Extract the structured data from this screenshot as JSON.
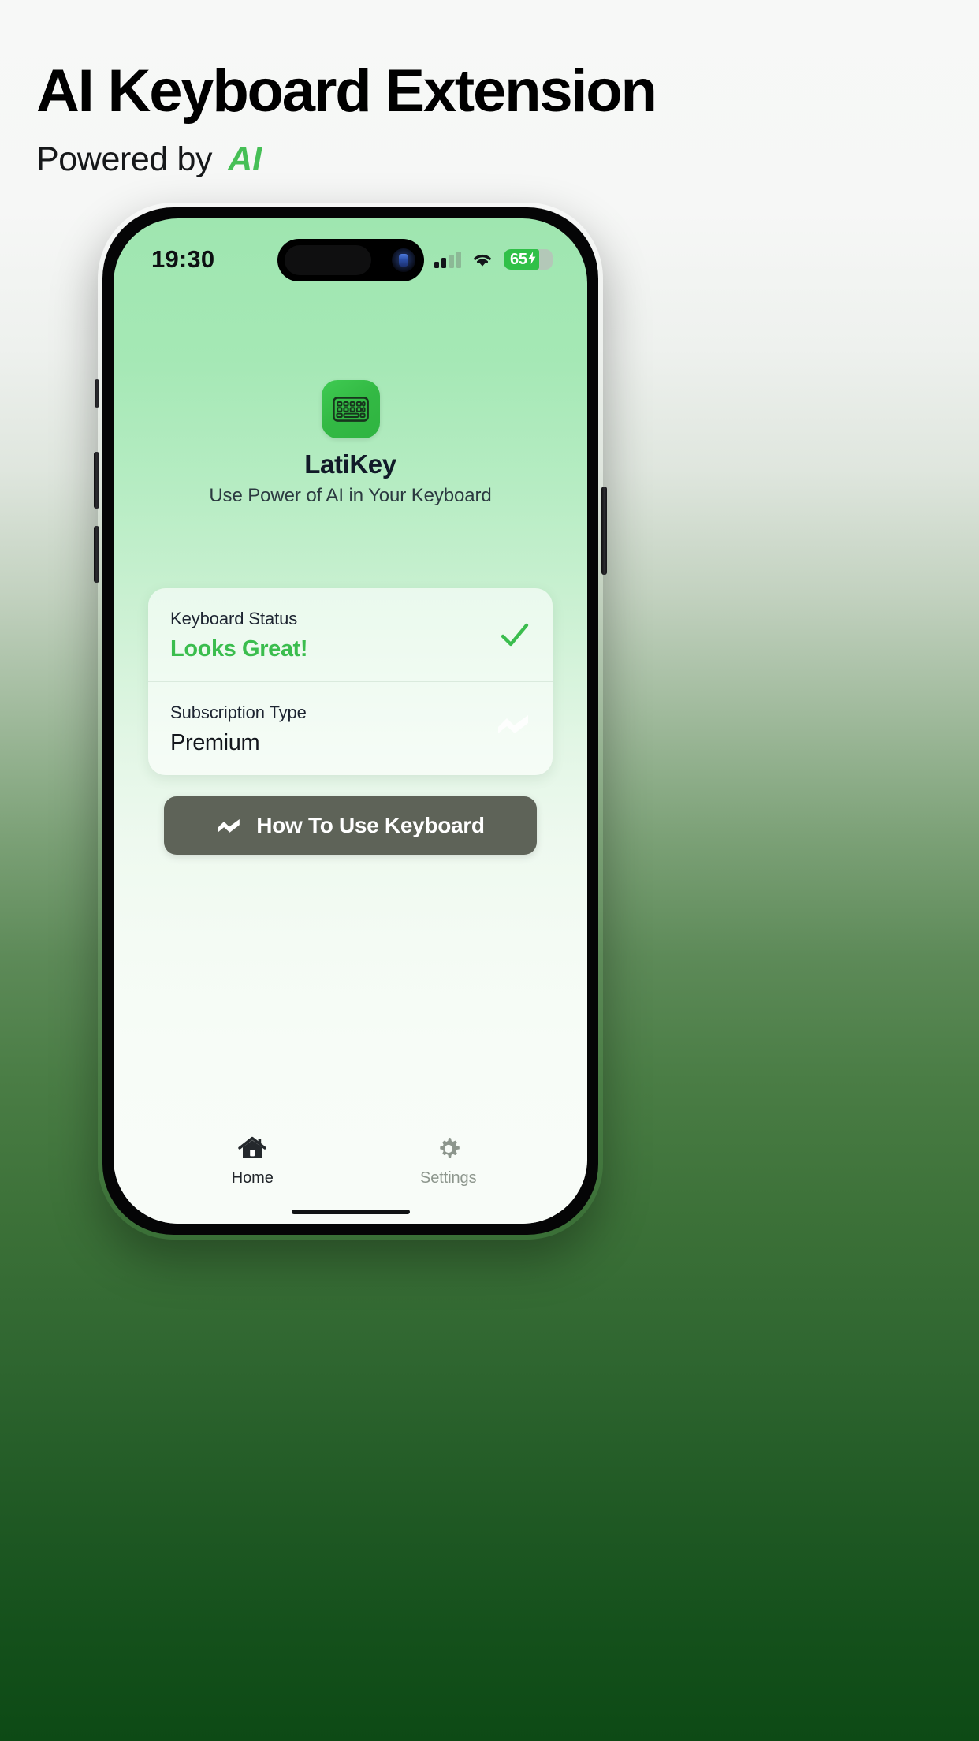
{
  "header": {
    "title": "AI Keyboard Extension",
    "subtitle_prefix": "Powered by",
    "subtitle_accent": "AI",
    "accent_color": "#46bf56"
  },
  "phone": {
    "status_bar": {
      "time": "19:30",
      "cellular_icon": "cellular-bars-icon",
      "wifi_icon": "wifi-icon",
      "battery_percent": "65",
      "battery_charging": true,
      "battery_bolt": "⚡",
      "battery_color": "#30c048"
    },
    "app": {
      "icon": "keyboard-app-icon",
      "icon_color": "#33b944",
      "name": "LatiKey",
      "tagline": "Use Power of AI in Your Keyboard"
    },
    "status_card": {
      "rows": [
        {
          "label": "Keyboard Status",
          "value": "Looks Great!",
          "value_color": "#3bbd4e",
          "icon": "check-icon"
        },
        {
          "label": "Subscription Type",
          "value": "Premium",
          "value_color": "#13161c",
          "icon": "zigzag-icon"
        }
      ]
    },
    "cta_button": {
      "label": "How To Use Keyboard",
      "icon": "zigzag-icon",
      "background": "#5e6358"
    },
    "tab_bar": {
      "tabs": [
        {
          "label": "Home",
          "icon": "home-icon",
          "active": true
        },
        {
          "label": "Settings",
          "icon": "gear-icon",
          "active": false
        }
      ]
    }
  }
}
